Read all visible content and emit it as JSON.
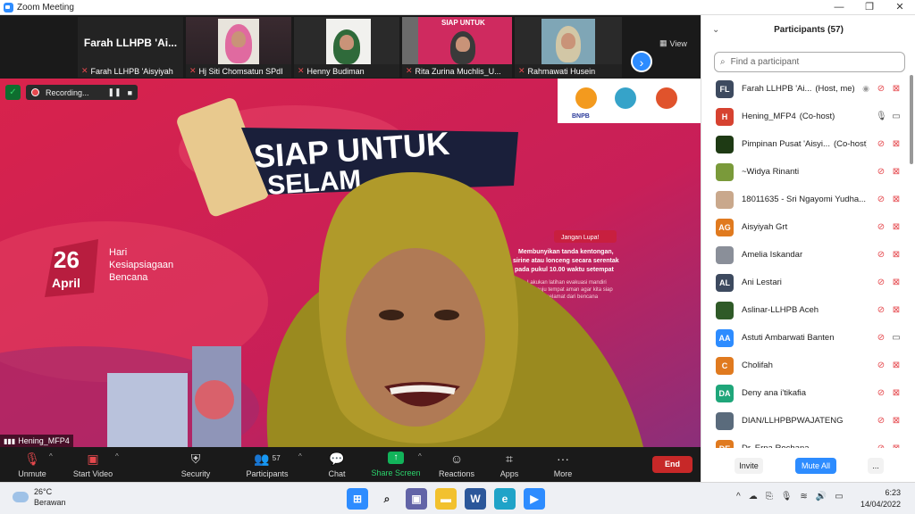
{
  "window": {
    "title": "Zoom Meeting",
    "controls": [
      "—",
      "❐",
      "✕"
    ]
  },
  "thumbnails": [
    {
      "name": "Farah LLHPB 'Aisyiyah",
      "display_name": "Farah LLHPB 'Ai..."
    },
    {
      "name": "Hj Siti Chomsatun SPdI"
    },
    {
      "name": "Henny Budiman"
    },
    {
      "name": "Rita Zurina Muchlis_U..."
    },
    {
      "name": "Rahmawati Husein"
    }
  ],
  "view_label": "View",
  "recording": {
    "label": "Recording..."
  },
  "main_speaker": {
    "name": "Hening_MFP4"
  },
  "toolbar": {
    "unmute": "Unmute",
    "start_video": "Start Video",
    "security": "Security",
    "participants": "Participants",
    "participants_count": "57",
    "chat": "Chat",
    "share_screen": "Share Screen",
    "reactions": "Reactions",
    "apps": "Apps",
    "more": "More",
    "end": "End"
  },
  "panel": {
    "title": "Participants (57)",
    "search_placeholder": "Find a participant",
    "participants": [
      {
        "initials": "FL",
        "color": "#3d4a5f",
        "name": "Farah LLHPB 'Ai...",
        "role": "(Host, me)",
        "mic": "off",
        "cam": "off",
        "host": true
      },
      {
        "initials": "H",
        "color": "#d64230",
        "name": "Hening_MFP4",
        "role": "(Co-host)",
        "mic": "on",
        "cam": "on"
      },
      {
        "initials": "",
        "color": "#1e3a14",
        "name": "Pimpinan Pusat 'Aisyi...",
        "role": "(Co-host)",
        "mic": "off",
        "cam": "off"
      },
      {
        "initials": "",
        "color": "#7a9a3a",
        "name": "~Widya Rinanti",
        "role": "",
        "mic": "off",
        "cam": "off"
      },
      {
        "initials": "",
        "color": "#c9a88c",
        "name": "18011635 - Sri Ngayomi Yudha...",
        "role": "",
        "mic": "off",
        "cam": "off"
      },
      {
        "initials": "AG",
        "color": "#e07a1f",
        "name": "Aisyiyah Grt",
        "role": "",
        "mic": "off",
        "cam": "off"
      },
      {
        "initials": "",
        "color": "#8a8f99",
        "name": "Amelia Iskandar",
        "role": "",
        "mic": "off",
        "cam": "off"
      },
      {
        "initials": "AL",
        "color": "#3d4a5f",
        "name": "Ani Lestari",
        "role": "",
        "mic": "off",
        "cam": "off"
      },
      {
        "initials": "",
        "color": "#2f5a28",
        "name": "Aslinar-LLHPB Aceh",
        "role": "",
        "mic": "off",
        "cam": "off"
      },
      {
        "initials": "AA",
        "color": "#2d8cff",
        "name": "Astuti Ambarwati Banten",
        "role": "",
        "mic": "off",
        "cam": "on"
      },
      {
        "initials": "C",
        "color": "#e07a1f",
        "name": "Cholifah",
        "role": "",
        "mic": "off",
        "cam": "off"
      },
      {
        "initials": "DA",
        "color": "#1fa67a",
        "name": "Deny ana i'tikafia",
        "role": "",
        "mic": "off",
        "cam": "off"
      },
      {
        "initials": "",
        "color": "#5a6b7c",
        "name": "DIAN/LLHPBPWAJATENG",
        "role": "",
        "mic": "off",
        "cam": "off"
      },
      {
        "initials": "DE",
        "color": "#e07a1f",
        "name": "Dr. Erna Rochana",
        "role": "",
        "mic": "off",
        "cam": "off"
      }
    ],
    "invite": "Invite",
    "mute_all": "Mute All",
    "more": "..."
  },
  "taskbar": {
    "temperature": "26°C",
    "weather": "Berawan",
    "time": "6:23",
    "date": "14/04/2022"
  }
}
